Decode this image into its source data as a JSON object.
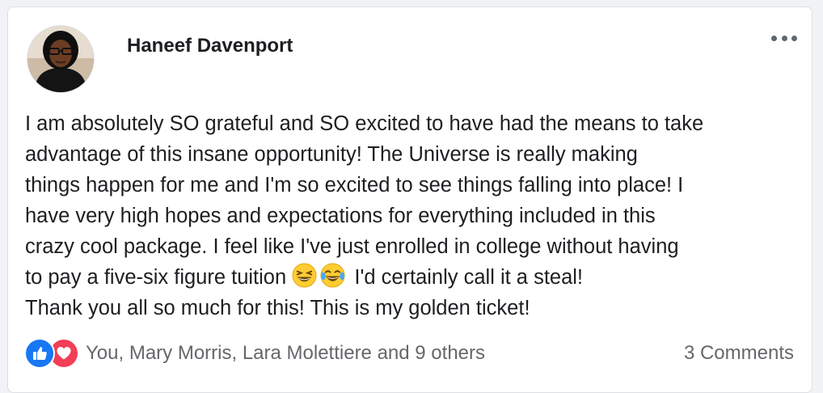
{
  "post": {
    "author": "Haneef Davenport",
    "body_lines": [
      "I am absolutely SO grateful and SO excited to have had the means to take",
      "advantage of this insane opportunity! The Universe is really making",
      "things happen for me and I'm so excited to see things falling into place! I",
      "have very high hopes and expectations for everything included in this",
      "crazy cool package. I feel like I've just enrolled in college without having",
      "to pay a five-six figure tuition",
      "I'd certainly call it a steal!",
      "Thank you all so much for this! This is my golden ticket!"
    ],
    "emojis": [
      "grinning-squinting-face",
      "face-with-tears-of-joy"
    ]
  },
  "reactions": {
    "types": [
      "like",
      "love"
    ],
    "names": "You, Mary Morris, Lara Molettiere and 9 others"
  },
  "comments": {
    "label": "3 Comments"
  },
  "colors": {
    "like": "#1877f2",
    "love": "#f33e58",
    "text": "#1c1e21",
    "secondary": "#65676b"
  }
}
